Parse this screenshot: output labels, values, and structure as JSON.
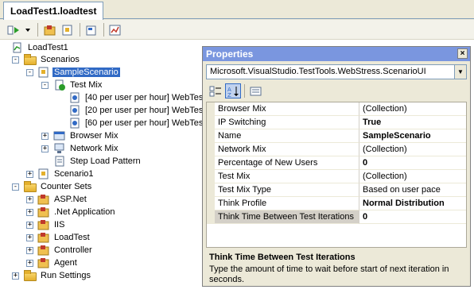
{
  "document_tab": {
    "label": "LoadTest1.loadtest"
  },
  "toolbar": {
    "buttons": [
      "run-icon",
      "dropdown-icon",
      "counter-set-icon",
      "scenario-icon",
      "context-icon",
      "manage-icon"
    ]
  },
  "tree": {
    "root": "LoadTest1",
    "scenarios": "Scenarios",
    "sample_scenario": "SampleScenario",
    "test_mix": "Test Mix",
    "test_1": "[40 per user per hour] WebTes",
    "test_2": "[20 per user per hour] WebTes",
    "test_3": "[60 per user per hour] WebTes",
    "browser_mix": "Browser Mix",
    "network_mix": "Network Mix",
    "step_load": "Step Load Pattern",
    "scenario1": "Scenario1",
    "counter_sets": "Counter Sets",
    "aspnet": "ASP.Net",
    "netapp": ".Net Application",
    "iis": "IIS",
    "loadtest": "LoadTest",
    "controller": "Controller",
    "agent": "Agent",
    "run_settings": "Run Settings"
  },
  "properties": {
    "title": "Properties",
    "close": "×",
    "object": "Microsoft.VisualStudio.TestTools.WebStress.ScenarioUI",
    "rows": [
      {
        "name": "Browser Mix",
        "value": "(Collection)",
        "bold": false
      },
      {
        "name": "IP Switching",
        "value": "True",
        "bold": true
      },
      {
        "name": "Name",
        "value": "SampleScenario",
        "bold": true
      },
      {
        "name": "Network Mix",
        "value": "(Collection)",
        "bold": false
      },
      {
        "name": "Percentage of New Users",
        "value": "0",
        "bold": true
      },
      {
        "name": "Test Mix",
        "value": "(Collection)",
        "bold": false
      },
      {
        "name": "Test Mix Type",
        "value": "Based on user pace",
        "bold": false
      },
      {
        "name": "Think Profile",
        "value": "Normal Distribution",
        "bold": true
      },
      {
        "name": "Think Time Between Test Iterations",
        "value": "0",
        "bold": true
      }
    ],
    "description_title": "Think Time Between Test Iterations",
    "description_text": "Type the amount of time to wait before start of next iteration in seconds."
  }
}
